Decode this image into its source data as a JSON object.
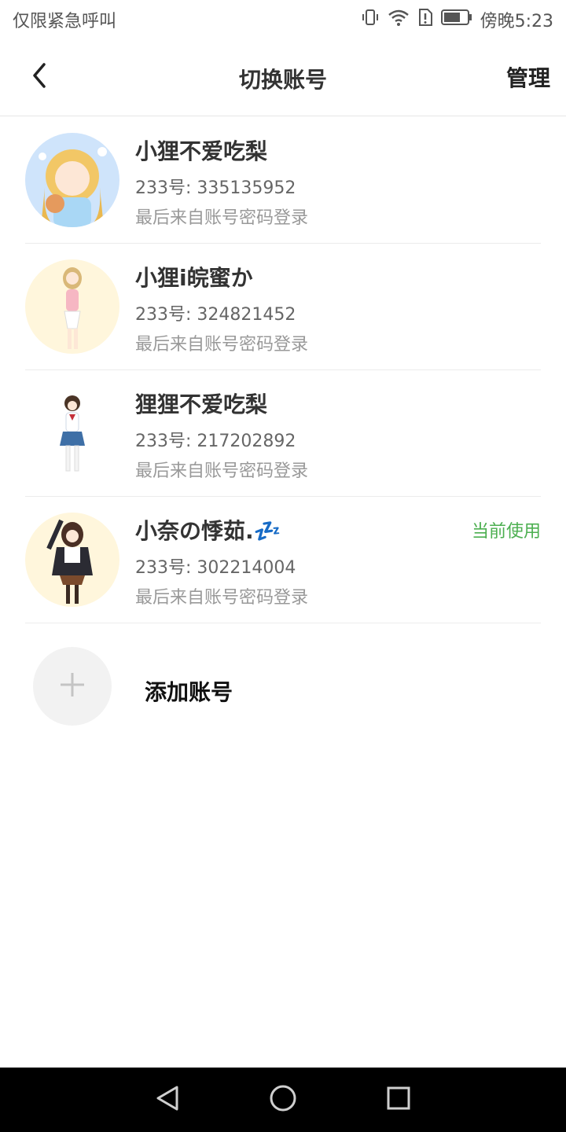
{
  "status": {
    "left_text": "仅限紧急呼叫",
    "time": "傍晚5:23",
    "icons": [
      "vibrate-icon",
      "wifi-icon",
      "sim-alert-icon",
      "battery-icon"
    ]
  },
  "header": {
    "title": "切换账号",
    "manage_label": "管理",
    "back_icon": "chevron-left-icon"
  },
  "accounts": [
    {
      "name": "小狸不爱吃梨",
      "id_text": "233号: 335135952",
      "login_text": "最后来自账号密码登录",
      "current_label": ""
    },
    {
      "name": "小狸i皖蜜か",
      "id_text": "233号: 324821452",
      "login_text": "最后来自账号密码登录",
      "current_label": ""
    },
    {
      "name": "狸狸不爱吃梨",
      "id_text": "233号: 217202892",
      "login_text": "最后来自账号密码登录",
      "current_label": ""
    },
    {
      "name": "小奈の悸茹.💤",
      "id_text": "233号: 302214004",
      "login_text": "最后来自账号密码登录",
      "current_label": "当前使用"
    }
  ],
  "add_account": {
    "label": "添加账号",
    "icon": "plus-icon"
  },
  "nav": {
    "icons": [
      "back-triangle-icon",
      "home-circle-icon",
      "recents-square-icon"
    ]
  },
  "colors": {
    "current_green": "#4caf50",
    "text_dark": "#333333",
    "text_gray": "#999999"
  }
}
